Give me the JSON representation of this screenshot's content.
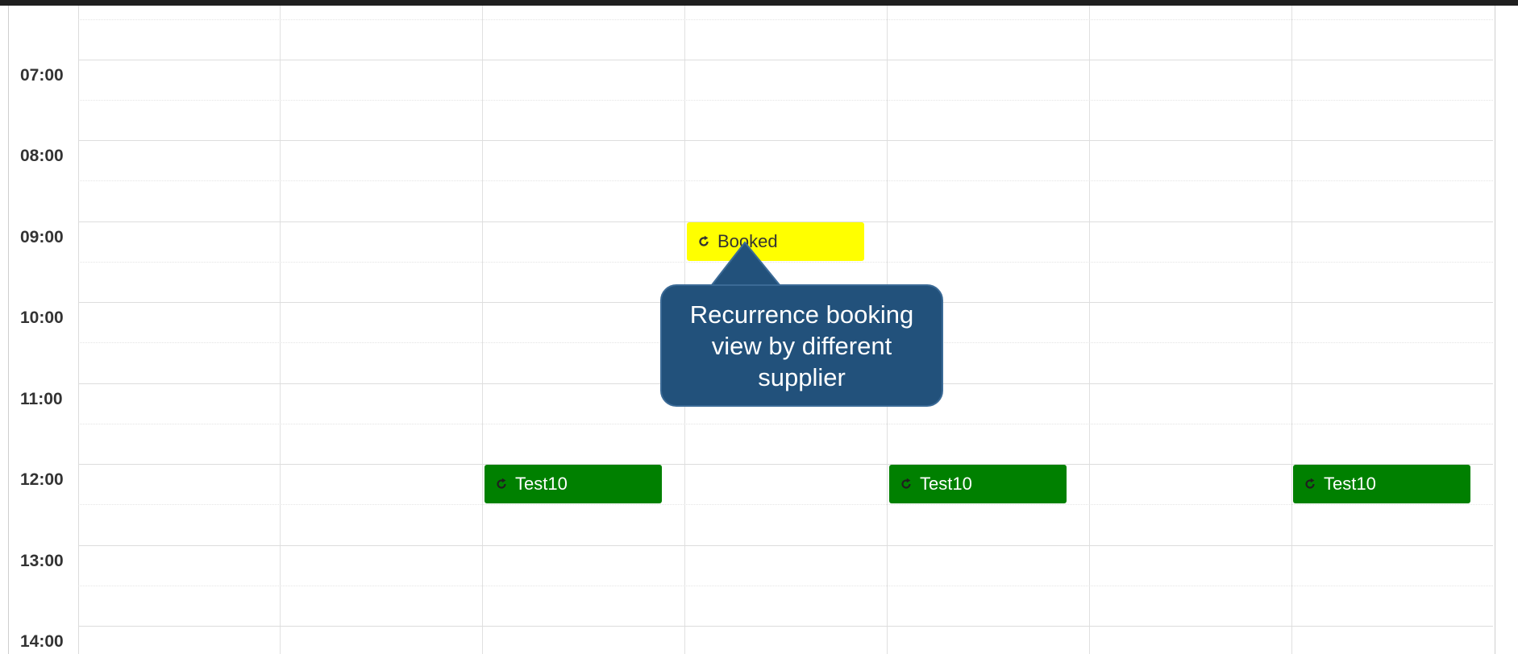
{
  "times": [
    "07:00",
    "08:00",
    "09:00",
    "10:00",
    "11:00",
    "12:00",
    "13:00",
    "14:00"
  ],
  "events": {
    "booked": {
      "label": "Booked",
      "color": "#ffff00",
      "icon": "refresh-icon"
    },
    "test_a": {
      "label": "Test10",
      "color": "#008000",
      "icon": "refresh-icon"
    },
    "test_b": {
      "label": "Test10",
      "color": "#008000",
      "icon": "refresh-icon"
    },
    "test_c": {
      "label": "Test10",
      "color": "#008000",
      "icon": "refresh-icon"
    }
  },
  "callout": {
    "text": "Recurrence booking view by different supplier",
    "color": "#22517b"
  }
}
